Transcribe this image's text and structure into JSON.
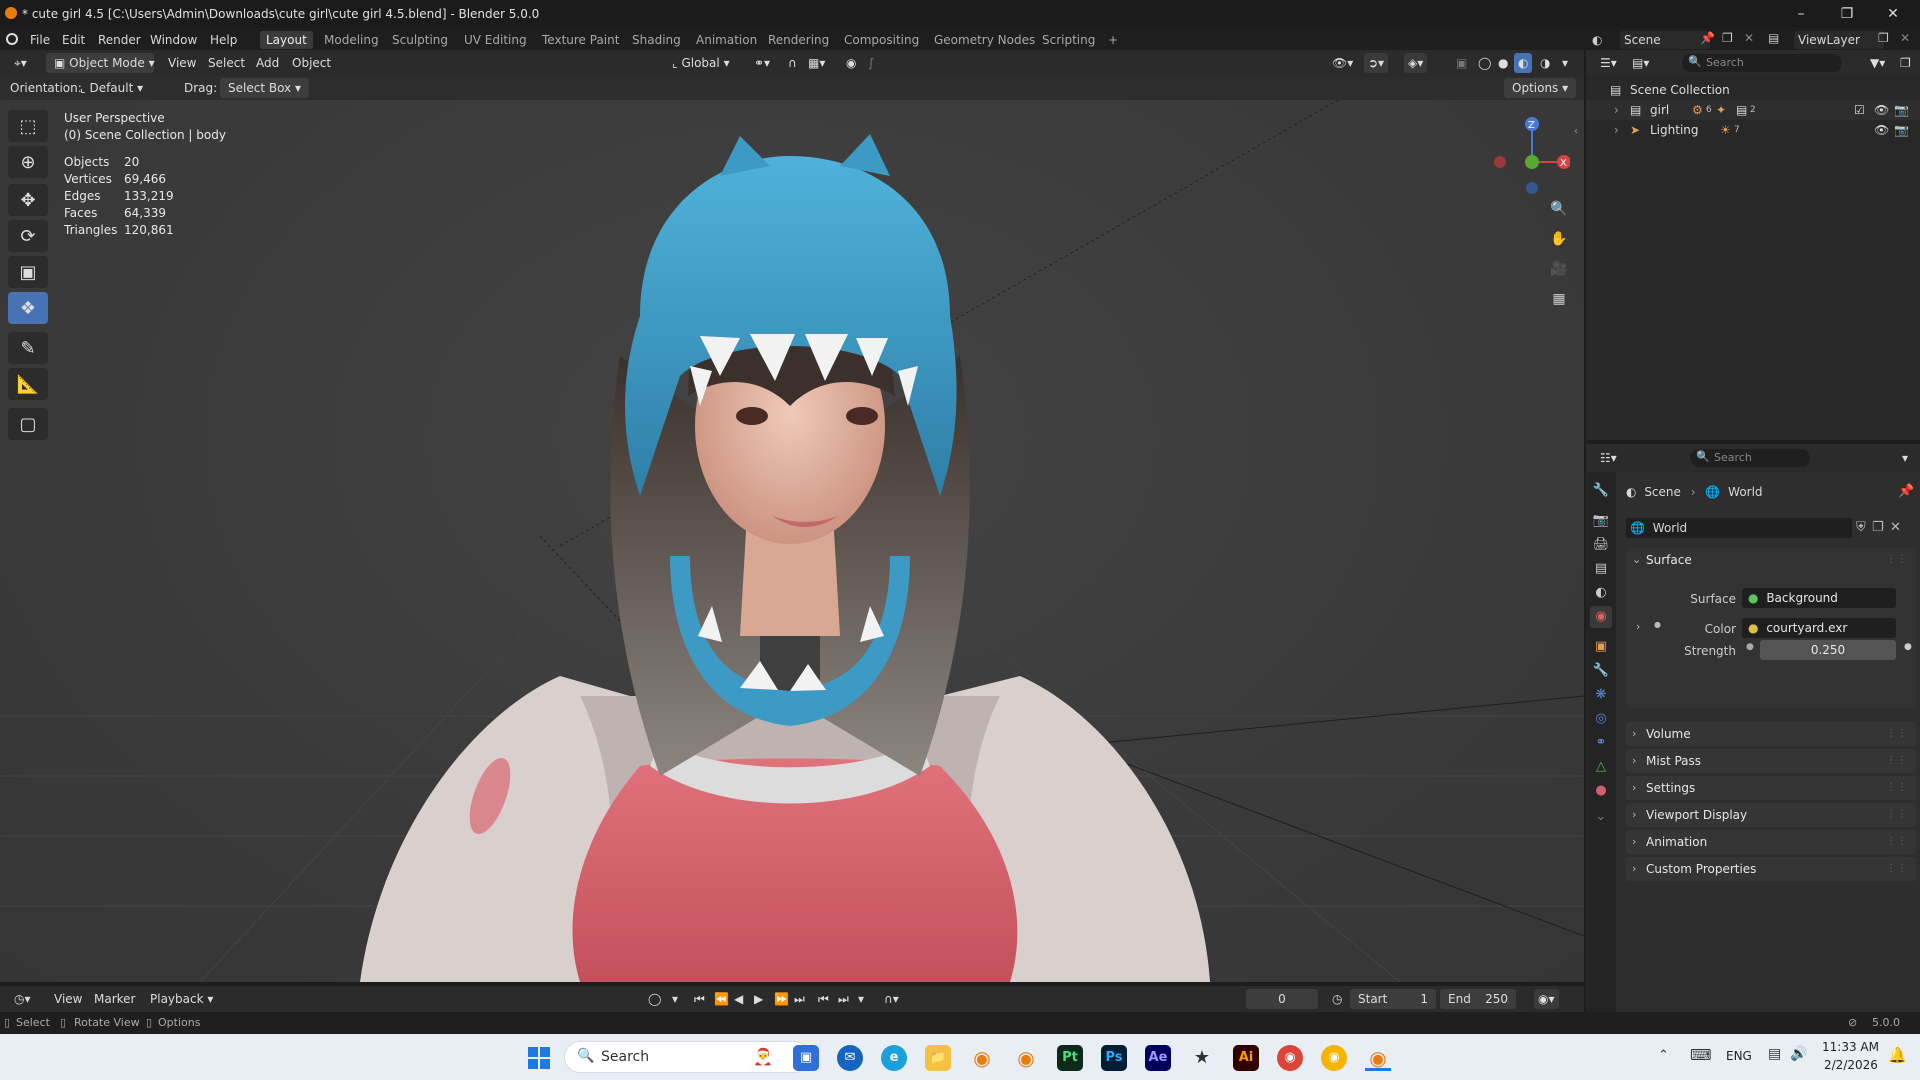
{
  "window": {
    "title": "* cute girl 4.5 [C:\\Users\\Admin\\Downloads\\cute girl\\cute girl 4.5.blend] - Blender 5.0.0"
  },
  "menu": {
    "items": [
      "File",
      "Edit",
      "Render",
      "Window",
      "Help"
    ],
    "workspaces": [
      "Layout",
      "Modeling",
      "Sculpting",
      "UV Editing",
      "Texture Paint",
      "Shading",
      "Animation",
      "Rendering",
      "Compositing",
      "Geometry Nodes",
      "Scripting"
    ],
    "active_workspace": "Layout",
    "add_tab": "+"
  },
  "scene_selector": {
    "scene": "Scene",
    "view_layer": "ViewLayer"
  },
  "viewport_header": {
    "mode": "Object Mode",
    "menus": [
      "View",
      "Select",
      "Add",
      "Object"
    ],
    "transform_orientation": "Global"
  },
  "tool_options": {
    "orientation_label": "Orientation:",
    "orientation_value": "Default",
    "drag_label": "Drag:",
    "drag_value": "Select Box",
    "options": "Options"
  },
  "viewport": {
    "perspective": "User Perspective",
    "context": "(0) Scene Collection | body",
    "stats": [
      {
        "label": "Objects",
        "value": "20"
      },
      {
        "label": "Vertices",
        "value": "69,466"
      },
      {
        "label": "Edges",
        "value": "133,219"
      },
      {
        "label": "Faces",
        "value": "64,339"
      },
      {
        "label": "Triangles",
        "value": "120,861"
      }
    ],
    "gizmo_axes": {
      "z": "Z",
      "x": "X"
    }
  },
  "outliner": {
    "search_placeholder": "Search",
    "root": "Scene Collection",
    "items": [
      {
        "name": "girl",
        "badge1": "6",
        "badge2": "2"
      },
      {
        "name": "Lighting",
        "badge1": "7"
      }
    ]
  },
  "properties": {
    "search_placeholder": "Search",
    "breadcrumb": [
      "Scene",
      "World"
    ],
    "datablock": "World",
    "surface_panel": "Surface",
    "surface_label": "Surface",
    "surface_value": "Background",
    "color_label": "Color",
    "color_value": "courtyard.exr",
    "strength_label": "Strength",
    "strength_value": "0.250",
    "panels": [
      "Volume",
      "Mist Pass",
      "Settings",
      "Viewport Display",
      "Animation",
      "Custom Properties"
    ]
  },
  "timeline": {
    "menus": [
      "View",
      "Marker",
      "Playback"
    ],
    "current_frame": "0",
    "start_label": "Start",
    "start_value": "1",
    "end_label": "End",
    "end_value": "250"
  },
  "statusbar": {
    "select": "Select",
    "rotate": "Rotate View",
    "options": "Options",
    "version": "5.0.0"
  },
  "taskbar": {
    "search_placeholder": "Search",
    "lang": "ENG",
    "time": "11:33 AM",
    "date": "2/2/2026",
    "app_labels": {
      "pt": "Pt",
      "ps": "Ps",
      "ae": "Ae",
      "ai": "Ai"
    }
  },
  "colors": {
    "accent": "#4772b3",
    "hat": "#3d9ac4",
    "shirt": "#d4606a",
    "hoodie": "#d9cfcd",
    "taskbar": "#e9eef5"
  }
}
